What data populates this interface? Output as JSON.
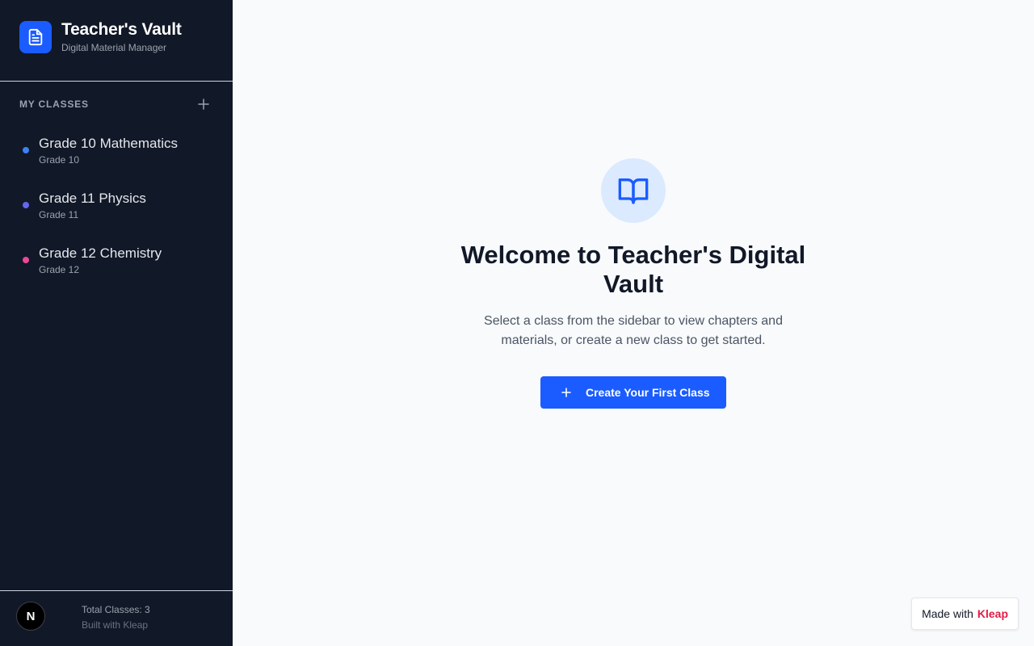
{
  "brand": {
    "title": "Teacher's Vault",
    "subtitle": "Digital Material Manager",
    "icon": "document-icon",
    "color": "#1a5cff"
  },
  "sidebar": {
    "section_title": "MY CLASSES",
    "add_icon": "plus-icon",
    "classes": [
      {
        "name": "Grade 10 Mathematics",
        "grade": "Grade 10",
        "color": "#3b82f6"
      },
      {
        "name": "Grade 11 Physics",
        "grade": "Grade 11",
        "color": "#6366f1"
      },
      {
        "name": "Grade 12 Chemistry",
        "grade": "Grade 12",
        "color": "#ec4899"
      }
    ],
    "footer": {
      "badge_letter": "N",
      "total_classes": "Total Classes: 3",
      "built_with": "Built with Kleap"
    }
  },
  "main": {
    "icon": "book-open-icon",
    "title": "Welcome to Teacher's Digital Vault",
    "description": "Select a class from the sidebar to view chapters and materials, or create a new class to get started.",
    "cta_label": "Create Your First Class"
  },
  "made_with": {
    "prefix": "Made with",
    "brand": "Kleap"
  }
}
